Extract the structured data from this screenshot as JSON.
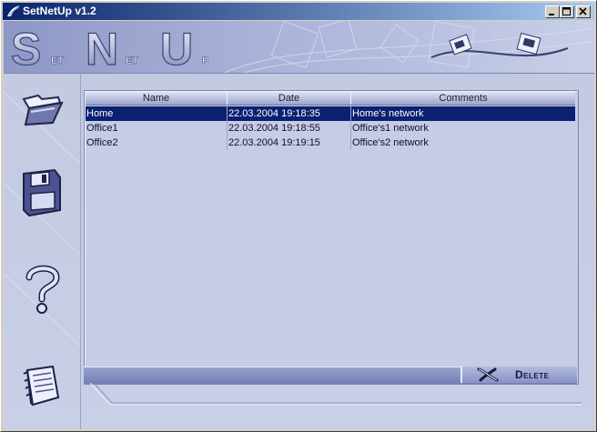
{
  "window": {
    "title": "SetNetUp v1.2"
  },
  "banner": {
    "logo_letters": [
      "S",
      "N",
      "U"
    ],
    "logo_small": [
      "ET",
      "ET",
      "P"
    ]
  },
  "list": {
    "columns": [
      "Name",
      "Date",
      "Comments"
    ],
    "rows": [
      {
        "name": "Home",
        "date": "22.03.2004 19:18:35",
        "comment": "Home's network",
        "selected": true
      },
      {
        "name": "Office1",
        "date": "22.03.2004 19:18:55",
        "comment": "Office's1 network",
        "selected": false
      },
      {
        "name": "Office2",
        "date": "22.03.2004 19:19:15",
        "comment": "Office's2 network",
        "selected": false
      }
    ]
  },
  "actions": {
    "delete_label": "Delete"
  },
  "side_icons": [
    "open-folder-icon",
    "floppy-save-icon",
    "help-question-icon",
    "notepad-icon"
  ],
  "colors": {
    "title_bar": "#0a246a",
    "selection": "#0a2070",
    "panel_bg": "#c6cce6"
  }
}
